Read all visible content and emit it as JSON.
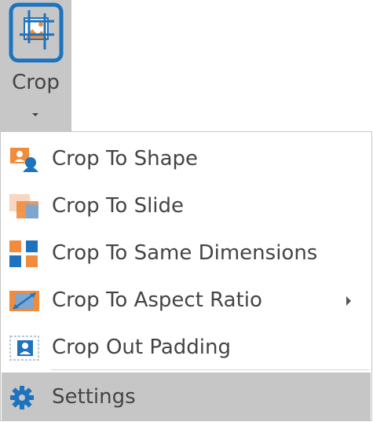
{
  "ribbon": {
    "crop_label": "Crop",
    "crop_icon": "crop-icon",
    "dropdown_icon": "chevron-down-icon"
  },
  "menu": {
    "items": [
      {
        "label": "Crop To Shape",
        "icon": "crop-to-shape-icon",
        "has_submenu": false
      },
      {
        "label": "Crop To Slide",
        "icon": "crop-to-slide-icon",
        "has_submenu": false
      },
      {
        "label": "Crop To Same Dimensions",
        "icon": "crop-to-same-dimensions-icon",
        "has_submenu": false
      },
      {
        "label": "Crop To Aspect Ratio",
        "icon": "crop-to-aspect-ratio-icon",
        "has_submenu": true
      },
      {
        "label": "Crop Out Padding",
        "icon": "crop-out-padding-icon",
        "has_submenu": false
      }
    ],
    "settings": {
      "label": "Settings",
      "icon": "gear-icon"
    }
  },
  "colors": {
    "accent_blue": "#1e73be",
    "accent_orange": "#f08c3c",
    "hover_gray": "#c6c6c6",
    "text": "#444444"
  }
}
